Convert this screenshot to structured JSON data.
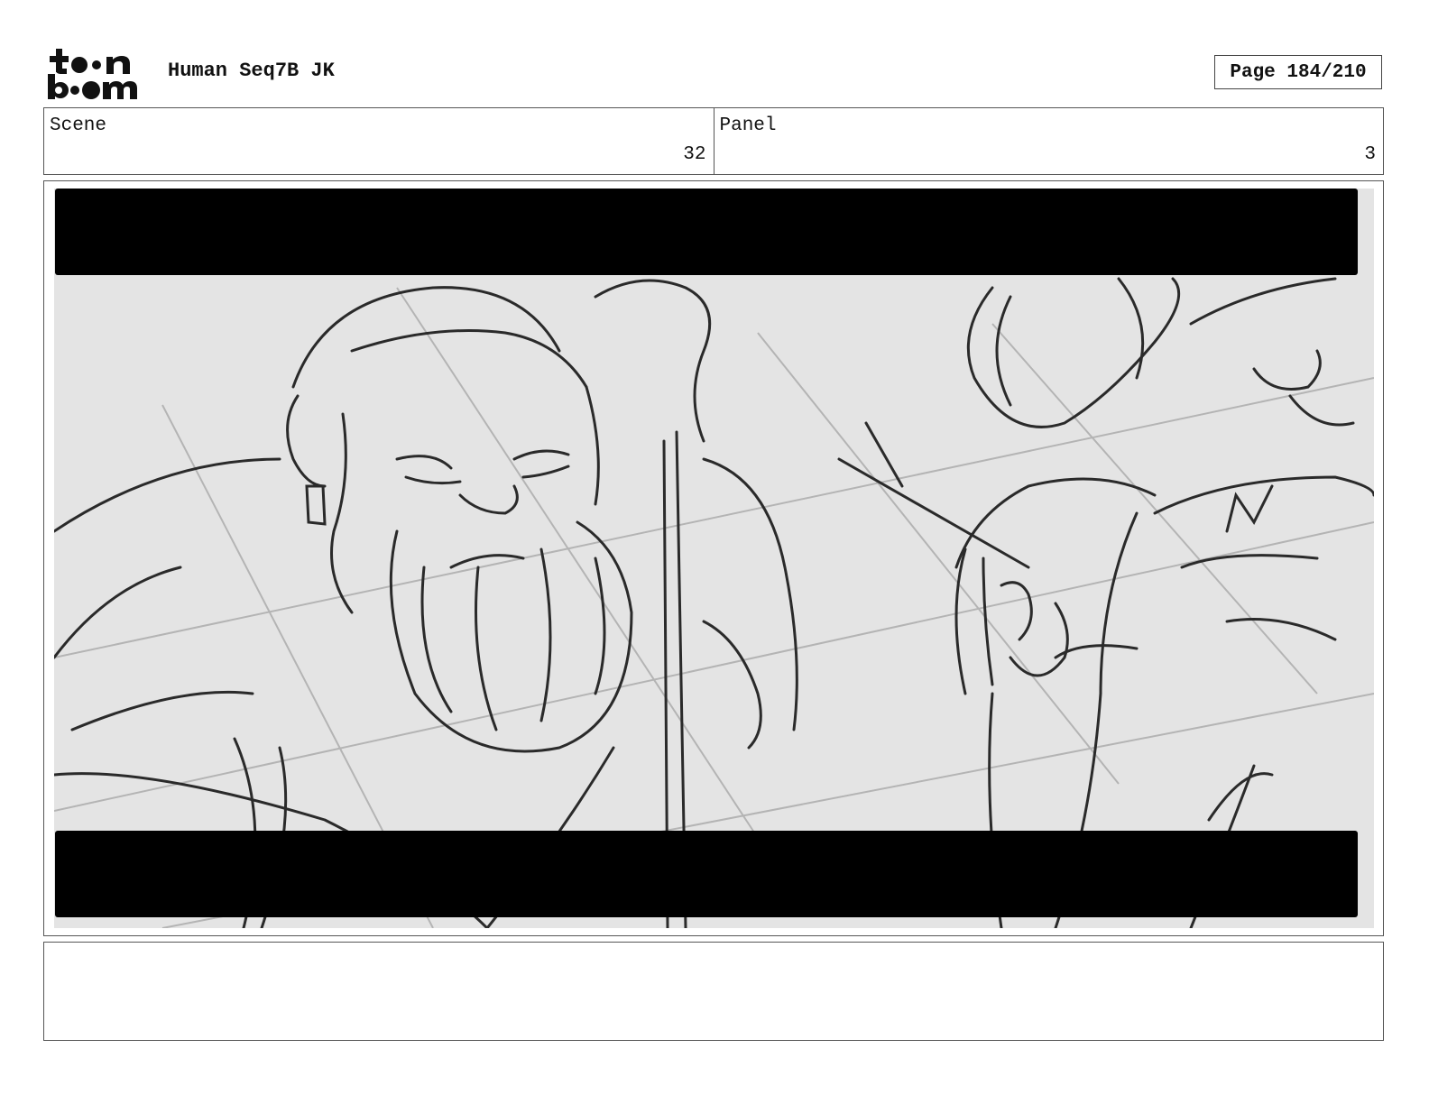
{
  "header": {
    "logo_name": "toon boom logo",
    "title": "Human Seq7B JK",
    "page": "Page 184/210"
  },
  "info": {
    "scene_label": "Scene",
    "scene_value": "32",
    "panel_label": "Panel",
    "panel_value": "3"
  },
  "notes": {
    "text": ""
  }
}
